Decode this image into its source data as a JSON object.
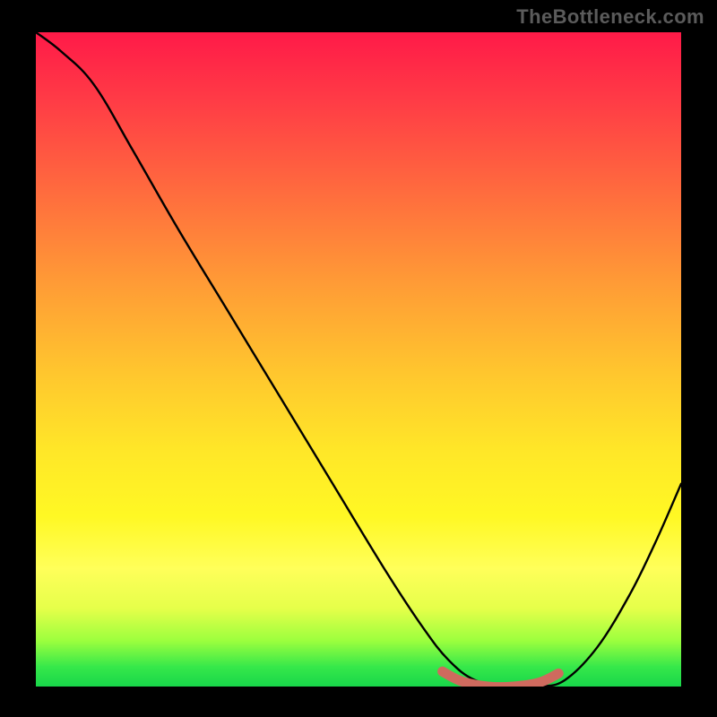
{
  "watermark": "TheBottleneck.com",
  "chart_data": {
    "type": "line",
    "title": "",
    "xlabel": "",
    "ylabel": "",
    "xlim": [
      0,
      1
    ],
    "ylim": [
      0,
      1
    ],
    "grid": false,
    "series": [
      {
        "name": "bottleneck-curve",
        "color": "#000000",
        "x": [
          0.0,
          0.04,
          0.09,
          0.15,
          0.22,
          0.3,
          0.38,
          0.46,
          0.54,
          0.6,
          0.64,
          0.68,
          0.73,
          0.78,
          0.82,
          0.87,
          0.92,
          0.96,
          1.0
        ],
        "y": [
          1.0,
          0.97,
          0.92,
          0.82,
          0.7,
          0.57,
          0.44,
          0.31,
          0.18,
          0.09,
          0.04,
          0.01,
          0.0,
          0.0,
          0.01,
          0.06,
          0.14,
          0.22,
          0.31
        ]
      },
      {
        "name": "optimal-band",
        "color": "#cf6a5e",
        "x": [
          0.63,
          0.66,
          0.7,
          0.74,
          0.78,
          0.81
        ],
        "y": [
          0.023,
          0.008,
          0.0,
          0.0,
          0.006,
          0.02
        ]
      }
    ],
    "gradient_stops": [
      {
        "pos": 0.0,
        "color": "#ff1a48"
      },
      {
        "pos": 0.1,
        "color": "#ff3a46"
      },
      {
        "pos": 0.24,
        "color": "#ff6a3e"
      },
      {
        "pos": 0.38,
        "color": "#ff9a36"
      },
      {
        "pos": 0.52,
        "color": "#ffc62e"
      },
      {
        "pos": 0.64,
        "color": "#ffe728"
      },
      {
        "pos": 0.74,
        "color": "#fff824"
      },
      {
        "pos": 0.82,
        "color": "#ffff5a"
      },
      {
        "pos": 0.88,
        "color": "#e6ff4a"
      },
      {
        "pos": 0.93,
        "color": "#9cff3e"
      },
      {
        "pos": 0.97,
        "color": "#36e84a"
      },
      {
        "pos": 1.0,
        "color": "#18d64a"
      }
    ]
  }
}
